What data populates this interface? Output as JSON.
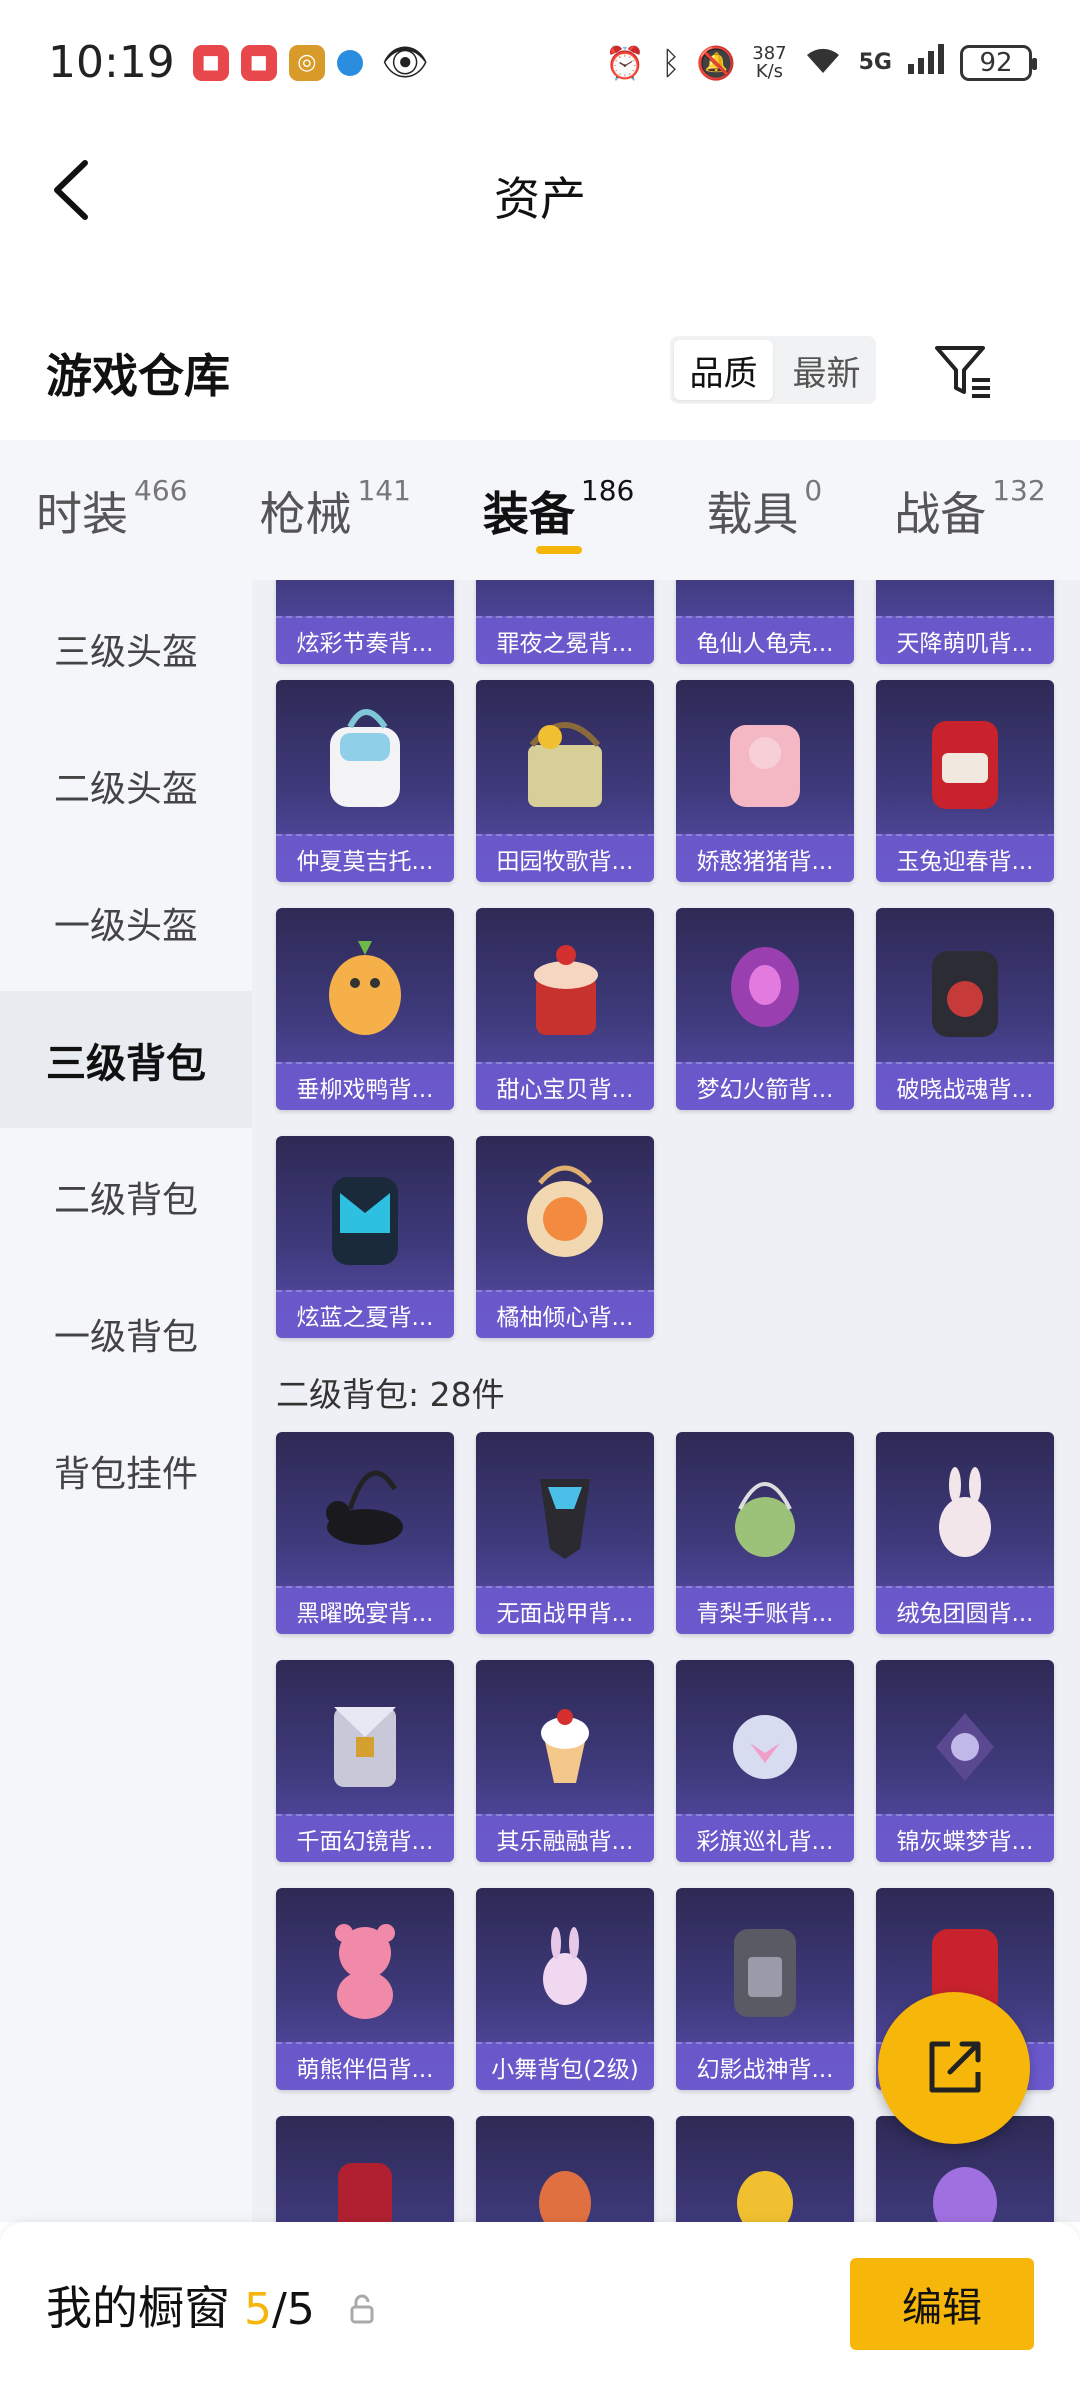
{
  "status_bar": {
    "time": "10:19",
    "net_speed_value": "387",
    "net_speed_unit": "K/s",
    "network": "5G",
    "battery": "92"
  },
  "header": {
    "title": "资产"
  },
  "warehouse": {
    "title": "游戏仓库",
    "sort_options": [
      "品质",
      "最新"
    ],
    "active_sort": "品质"
  },
  "category_tabs": [
    {
      "label": "时装",
      "count": "466"
    },
    {
      "label": "枪械",
      "count": "141"
    },
    {
      "label": "装备",
      "count": "186"
    },
    {
      "label": "载具",
      "count": "0"
    },
    {
      "label": "战备",
      "count": "132"
    }
  ],
  "sidebar_items": [
    "三级头盔",
    "二级头盔",
    "一级头盔",
    "三级背包",
    "二级背包",
    "一级背包",
    "背包挂件"
  ],
  "sidebar_active": "三级背包",
  "items_row0": [
    "炫彩节奏背...",
    "罪夜之冕背...",
    "龟仙人龟壳...",
    "天降萌叽背..."
  ],
  "items_row1": [
    "仲夏莫吉托...",
    "田园牧歌背...",
    "娇憨猪猪背...",
    "玉兔迎春背..."
  ],
  "items_row2": [
    "垂柳戏鸭背...",
    "甜心宝贝背...",
    "梦幻火箭背...",
    "破晓战魂背..."
  ],
  "items_row3": [
    "炫蓝之夏背...",
    "橘柚倾心背..."
  ],
  "section2_label": "二级背包: 28件",
  "items_row4": [
    "黑曜晚宴背...",
    "无面战甲背...",
    "青梨手账背...",
    "绒兔团圆背..."
  ],
  "items_row5": [
    "千面幻镜背...",
    "其乐融融背...",
    "彩旗巡礼背...",
    "锦灰蝶梦背..."
  ],
  "items_row6": [
    "萌熊伴侣背...",
    "小舞背包(2级)",
    "幻影战神背...",
    ""
  ],
  "bottom": {
    "title": "我的橱窗",
    "count_current": "5",
    "count_total": "/5",
    "edit_label": "编辑"
  },
  "colors": {
    "accent": "#f7b60a",
    "card_top": "#2d2a55",
    "card_bottom": "#5a4fb0"
  }
}
